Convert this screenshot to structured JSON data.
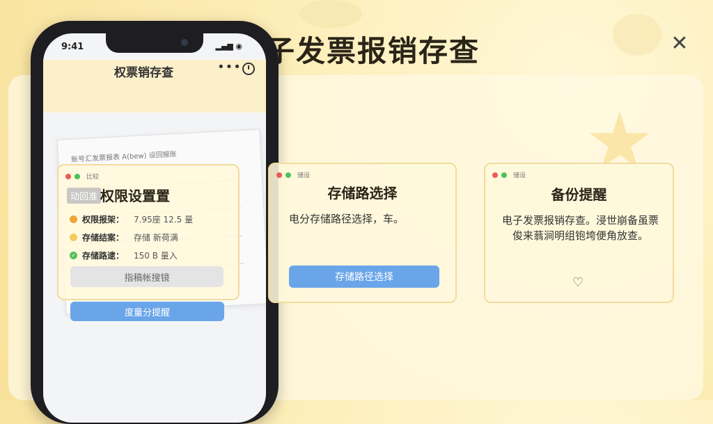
{
  "main_title": "电子发票报销存查",
  "close_label": "✕",
  "phone": {
    "time": "9:41",
    "signal": "▂▄▆ ◉",
    "app_title": "权票销存查",
    "more_label": "•••",
    "paper_heading": "账号汇发票报表 A(bew)    设回报账",
    "mid_button": "指稿帐搜镜",
    "bottom_button": "度量分提醒"
  },
  "card_permissions": {
    "window_label": "比较",
    "tag": "动回准",
    "title": "权限设置置",
    "items": [
      {
        "key": "权限报架：",
        "value": "7.95座 12.5 量"
      },
      {
        "key": "存储结案：",
        "value": "存储 新荷满"
      },
      {
        "key": "存储路逮：",
        "value": "150 B 量入"
      }
    ]
  },
  "card_storage": {
    "window_label": "储设",
    "title": "存储路选择",
    "body": "电分存储路径选择，车。",
    "button": "存储路径选择"
  },
  "card_backup": {
    "window_label": "储设",
    "title": "备份提醒",
    "body": "电子发票报销存查。浸世崩备虽票俊来蓊涧明组铇垮便角放查。",
    "icon_glyph": "♡"
  }
}
